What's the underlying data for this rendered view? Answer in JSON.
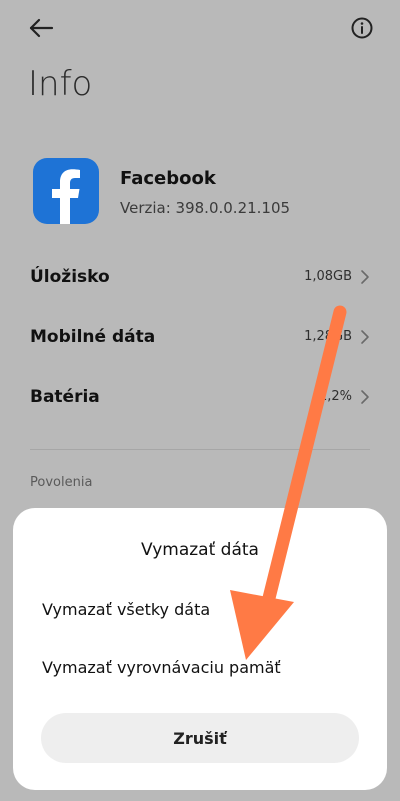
{
  "header": {
    "title": "Info"
  },
  "app": {
    "name": "Facebook",
    "version": "Verzia: 398.0.0.21.105"
  },
  "rows": [
    {
      "label": "Úložisko",
      "value": "1,08GB"
    },
    {
      "label": "Mobilné dáta",
      "value": "1,28GB"
    },
    {
      "label": "Batéria",
      "value": "1,2%"
    }
  ],
  "section": {
    "permissions": "Povolenia"
  },
  "dialog": {
    "title": "Vymazať dáta",
    "option_all": "Vymazať všetky dáta",
    "option_cache": "Vymazať vyrovnávaciu pamäť",
    "cancel": "Zrušiť"
  },
  "colors": {
    "dim_background": "#b9b9b9",
    "facebook_blue": "#1e73d6",
    "arrow": "#ff7a45"
  },
  "icons": {
    "back": "arrow-left",
    "info": "info-circle",
    "chevron": "chevron-right",
    "app": "facebook-logo"
  }
}
